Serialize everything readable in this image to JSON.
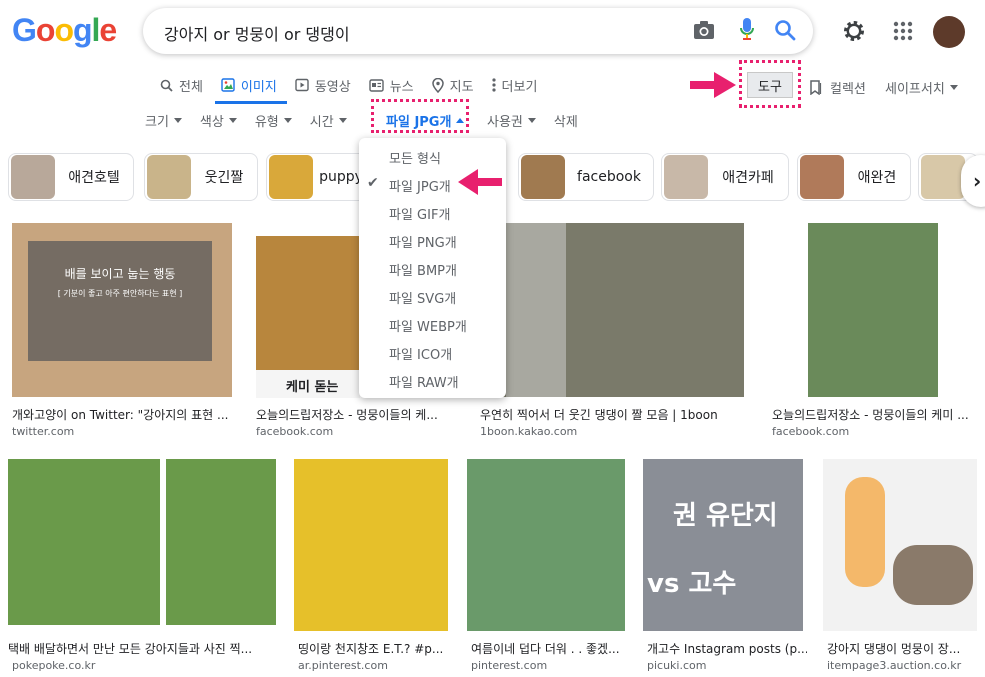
{
  "search": {
    "query": "강아지 or 멍뭉이 or 댕댕이"
  },
  "brand": {
    "letters": [
      "G",
      "o",
      "o",
      "g",
      "l",
      "e"
    ],
    "colors": [
      "#4285F4",
      "#EA4335",
      "#FBBC05",
      "#4285F4",
      "#34A853",
      "#EA4335"
    ]
  },
  "icons": {
    "camera": "camera-icon",
    "mic": "mic-icon",
    "search": "search-icon",
    "settings": "gear-icon",
    "apps": "apps-icon"
  },
  "tabs": [
    {
      "label": "전체",
      "icon": "search-icon",
      "active": false
    },
    {
      "label": "이미지",
      "icon": "image-icon",
      "active": true
    },
    {
      "label": "동영상",
      "icon": "video-icon",
      "active": false
    },
    {
      "label": "뉴스",
      "icon": "news-icon",
      "active": false
    },
    {
      "label": "지도",
      "icon": "map-pin-icon",
      "active": false
    },
    {
      "label": "더보기",
      "icon": "more-icon",
      "active": false
    }
  ],
  "toolbar": {
    "tools": "도구",
    "collection": "컬렉션",
    "safesearch": "세이프서치"
  },
  "filters": {
    "size": "크기",
    "color": "색상",
    "type": "유형",
    "time": "시간",
    "filetype": "파일 JPG개",
    "rights": "사용권",
    "clear": "삭제"
  },
  "chips": [
    {
      "label": "애견호텔",
      "color": "#b8a89a"
    },
    {
      "label": "웃긴짤",
      "color": "#c9b48a"
    },
    {
      "label": "puppy",
      "color": "#d9a83a"
    },
    {
      "label": "facebook",
      "color": "#a07a50"
    },
    {
      "label": "애견카페",
      "color": "#c8b8a8"
    },
    {
      "label": "애완견",
      "color": "#b07a5a"
    },
    {
      "label": "",
      "color": "#d8c8a8"
    }
  ],
  "dropdown": {
    "items": [
      "모든 형식",
      "파일 JPG개",
      "파일 GIF개",
      "파일 PNG개",
      "파일 BMP개",
      "파일 SVG개",
      "파일 WEBP개",
      "파일 ICO개",
      "파일 RAW개"
    ],
    "selected_index": 1
  },
  "results_row1": [
    {
      "title": "개와고양이 on Twitter: \"강아지의 표현 ...",
      "source": "twitter.com",
      "color": "#c7a57f",
      "overlay_title": "배를 보이고 눕는 행동",
      "overlay_sub": "[ 기분이 좋고 아주 편안하다는 표현 ]"
    },
    {
      "title": "오늘의드립저장소 - 멍뭉이들의 케...",
      "source": "facebook.com",
      "color": "#b8863d",
      "caption": "케미 돋는"
    },
    {
      "title": "우연히 찍어서 더 웃긴 댕댕이 짤 모음 | 1boon",
      "source": "1boon.kakao.com",
      "color": "#7a7a6a"
    },
    {
      "title": "오늘의드립저장소 - 멍뭉이들의 케미 ...",
      "source": "facebook.com",
      "color": "#6a8a5a"
    }
  ],
  "results_row2": [
    {
      "title": "택배 배달하면서 만난 모든 강아지들과 사진 찍...",
      "source": "pokepoke.co.kr",
      "color": "#6a9a4a"
    },
    {
      "title": "띵이랑 천지창조 E.T.? #p...",
      "source": "ar.pinterest.com",
      "color": "#e6c02a"
    },
    {
      "title": "여름이네 덥다 더워 . . 좋겠...",
      "source": "pinterest.com",
      "color": "#6a9a6a"
    },
    {
      "title": "개고수 Instagram posts (p...",
      "source": "picuki.com",
      "color": "#8a8e96",
      "text_top": "권 유단지",
      "text_bottom": "vs 고수"
    },
    {
      "title": "강아지 댕댕이 멍뭉이 장...",
      "source": "itempage3.auction.co.kr",
      "color": "#f2f2f2"
    }
  ]
}
